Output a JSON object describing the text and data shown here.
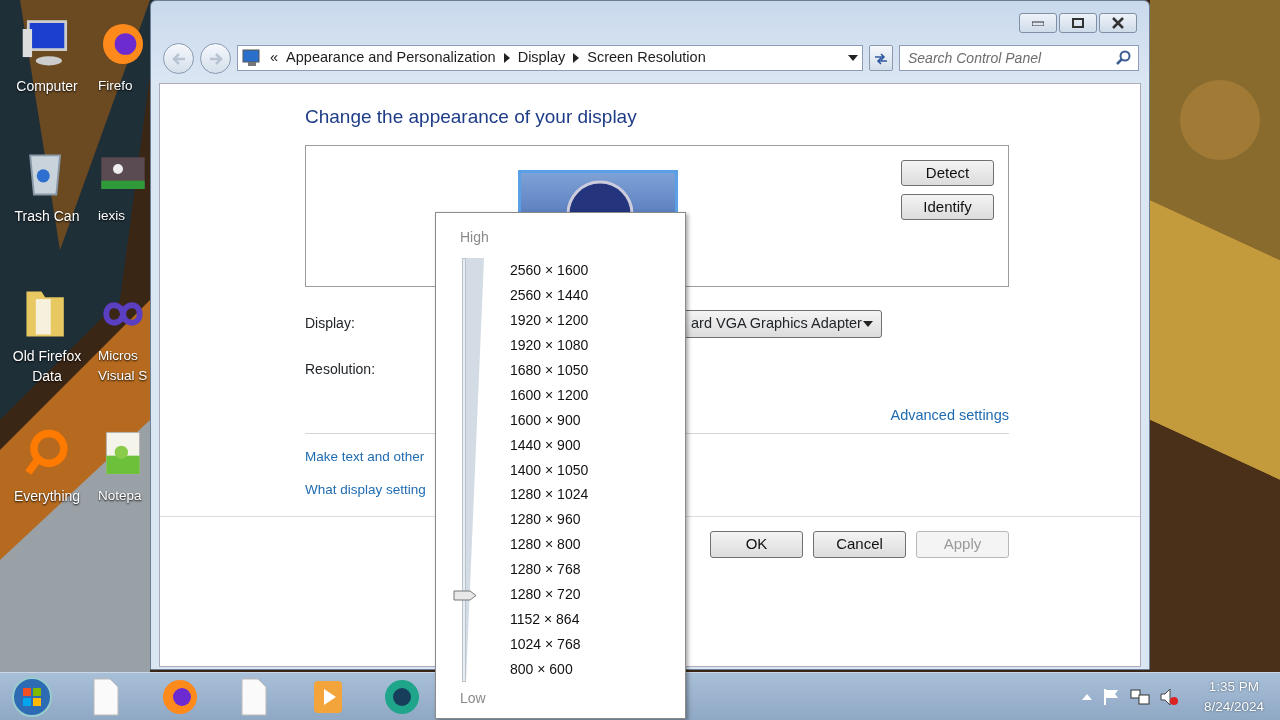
{
  "desktop_icons": [
    {
      "label": "Computer",
      "kind": "computer"
    },
    {
      "label": "Firefo",
      "kind": "firefox"
    },
    {
      "label": "Trash Can",
      "kind": "trash"
    },
    {
      "label": "iexis",
      "kind": "picture"
    },
    {
      "label": "Old Firefox Data",
      "kind": "folder"
    },
    {
      "label": "Micros Visual S",
      "kind": "vs"
    },
    {
      "label": "Everything",
      "kind": "everything"
    },
    {
      "label": "Notepa",
      "kind": "notepad"
    }
  ],
  "address_bar": {
    "breadcrumbs": [
      "Appearance and Personalization",
      "Display",
      "Screen Resolution"
    ],
    "overflow": "«"
  },
  "search": {
    "placeholder": "Search Control Panel"
  },
  "heading": "Change the appearance of your display",
  "preview_buttons": [
    {
      "label": "Detect",
      "disabled": false
    },
    {
      "label": "Identify",
      "disabled": false
    }
  ],
  "display": {
    "label": "Display:",
    "value": "ard VGA Graphics Adapter"
  },
  "resolution": {
    "label": "Resolution:"
  },
  "advanced_link": "Advanced settings",
  "links": [
    "Make text and other",
    "What display setting"
  ],
  "dialog_buttons": [
    {
      "label": "OK",
      "disabled": false
    },
    {
      "label": "Cancel",
      "disabled": false
    },
    {
      "label": "Apply",
      "disabled": true
    }
  ],
  "resolution_popup": {
    "high_label": "High",
    "low_label": "Low",
    "level": 0.1875,
    "options": [
      "2560 × 1600",
      "2560 × 1440",
      "1920 × 1200",
      "1920 × 1080",
      "1680 × 1050",
      "1600 × 1200",
      "1600 × 900",
      "1440 × 900",
      "1400 × 1050",
      "1280 × 1024",
      "1280 × 960",
      "1280 × 800",
      "1280 × 768",
      "1280 × 720",
      "1152 × 864",
      "1024 × 768",
      "800 × 600"
    ]
  },
  "taskbar": {
    "time": "1:35 PM",
    "date": "8/24/2024"
  }
}
